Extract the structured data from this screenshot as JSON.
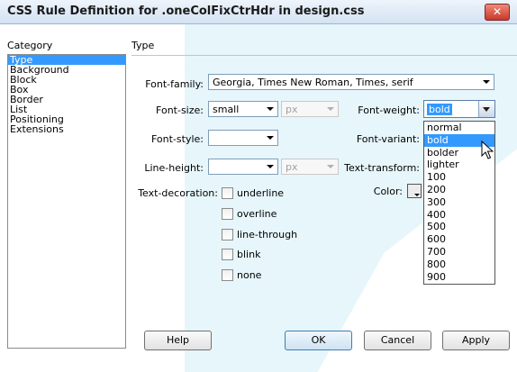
{
  "window": {
    "title": "CSS Rule Definition for .oneColFixCtrHdr in design.css",
    "close_glyph": "✕"
  },
  "category": {
    "label": "Category",
    "items": [
      "Type",
      "Background",
      "Block",
      "Box",
      "Border",
      "List",
      "Positioning",
      "Extensions"
    ],
    "selected": "Type"
  },
  "panel": {
    "heading": "Type"
  },
  "fields": {
    "font_family": {
      "label": "Font-family:",
      "value": "Georgia, Times New Roman, Times, serif"
    },
    "font_size": {
      "label": "Font-size:",
      "value": "small",
      "unit": "px"
    },
    "font_weight": {
      "label": "Font-weight:",
      "value": "bold"
    },
    "font_style": {
      "label": "Font-style:",
      "value": ""
    },
    "font_variant": {
      "label": "Font-variant:",
      "value": ""
    },
    "line_height": {
      "label": "Line-height:",
      "value": "",
      "unit": "px"
    },
    "text_transform": {
      "label": "Text-transform:",
      "value": ""
    },
    "text_decoration": {
      "label": "Text-decoration:",
      "options": [
        "underline",
        "overline",
        "line-through",
        "blink",
        "none"
      ]
    },
    "color": {
      "label": "Color:"
    }
  },
  "font_weight_options": [
    "normal",
    "bold",
    "bolder",
    "lighter",
    "100",
    "200",
    "300",
    "400",
    "500",
    "600",
    "700",
    "800",
    "900"
  ],
  "font_weight_selected": "bold",
  "buttons": {
    "help": "Help",
    "ok": "OK",
    "cancel": "Cancel",
    "apply": "Apply"
  },
  "colors": {
    "selection": "#3399ff",
    "titlebar": "#d4e2f3",
    "close": "#c8382a"
  },
  "icons": {
    "cursor": "arrow-cursor-icon",
    "close": "close-icon"
  }
}
